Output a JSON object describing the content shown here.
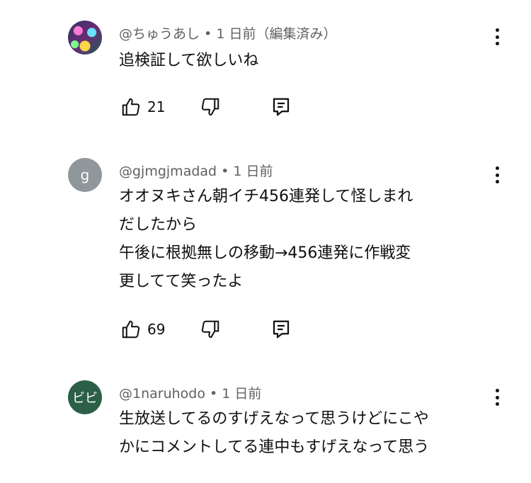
{
  "comments": [
    {
      "author": "@ちゅうあし",
      "sep": " • ",
      "time": "1 日前",
      "edited": "（編集済み）",
      "lines": [
        "追検証して欲しいね"
      ],
      "likes": "21",
      "avatar_icon": "avatar-image"
    },
    {
      "author": "@gjmgjmadad",
      "sep": " • ",
      "time": "1 日前",
      "avatar_letter": "g",
      "lines": [
        "オオヌキさん朝イチ456連発して怪しまれ",
        "だしたから",
        "午後に根拠無しの移動→456連発に作戦変",
        "更してて笑ったよ"
      ],
      "likes": "69"
    },
    {
      "author": "@1naruhodo",
      "sep": " • ",
      "time": "1 日前",
      "avatar_letter": "ビビ",
      "lines": [
        "生放送してるのすげえなって思うけどにこや",
        "かにコメントしてる連中もすげえなって思う"
      ]
    }
  ],
  "colors": {
    "meta": "#606060",
    "text": "#0f0f0f",
    "avatar_grey": "#8f979b",
    "avatar_green": "#2b5f47"
  }
}
